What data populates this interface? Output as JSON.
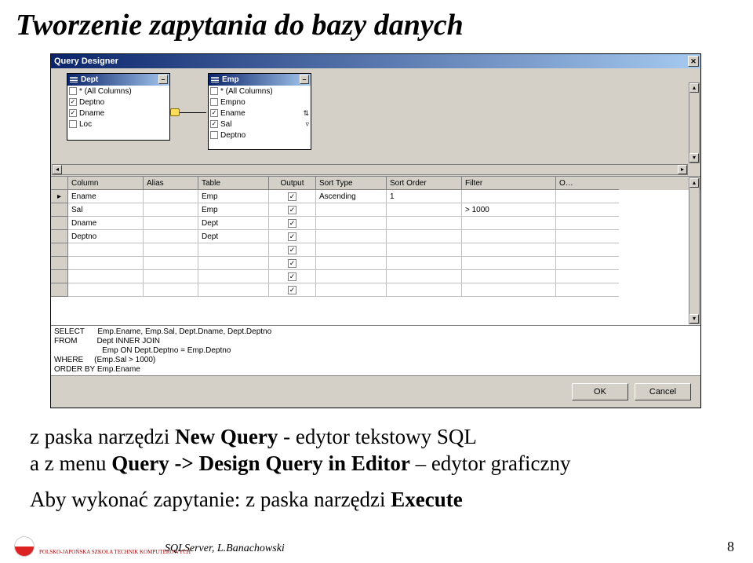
{
  "slide": {
    "title": "Tworzenie zapytania do bazy danych",
    "footer_center": "SQLServer, L.Banachowski",
    "page_num": "8",
    "logo_text": "POLSKO-JAPOŃSKA\nSZKOŁA TECHNIK KOMPUTEROWYCH"
  },
  "qd": {
    "window_title": "Query Designer",
    "tables": [
      {
        "name": "Dept",
        "cols": [
          {
            "label": "* (All Columns)",
            "checked": false
          },
          {
            "label": "Deptno",
            "checked": true
          },
          {
            "label": "Dname",
            "checked": true
          },
          {
            "label": "Loc",
            "checked": false
          }
        ]
      },
      {
        "name": "Emp",
        "cols": [
          {
            "label": "* (All Columns)",
            "checked": false
          },
          {
            "label": "Empno",
            "checked": false
          },
          {
            "label": "Ename",
            "checked": true,
            "sort": "↕"
          },
          {
            "label": "Sal",
            "checked": true,
            "filter": "▾"
          },
          {
            "label": "Deptno",
            "checked": false
          }
        ]
      }
    ],
    "grid_headers": [
      "Column",
      "Alias",
      "Table",
      "Output",
      "Sort Type",
      "Sort Order",
      "Filter",
      "O…"
    ],
    "grid_rows": [
      {
        "column": "Ename",
        "alias": "",
        "table": "Emp",
        "output": true,
        "sort_type": "Ascending",
        "sort_order": "1",
        "filter": ""
      },
      {
        "column": "Sal",
        "alias": "",
        "table": "Emp",
        "output": true,
        "sort_type": "",
        "sort_order": "",
        "filter": "> 1000"
      },
      {
        "column": "Dname",
        "alias": "",
        "table": "Dept",
        "output": true,
        "sort_type": "",
        "sort_order": "",
        "filter": ""
      },
      {
        "column": "Deptno",
        "alias": "",
        "table": "Dept",
        "output": true,
        "sort_type": "",
        "sort_order": "",
        "filter": ""
      },
      {
        "column": "",
        "alias": "",
        "table": "",
        "output": true,
        "sort_type": "",
        "sort_order": "",
        "filter": ""
      },
      {
        "column": "",
        "alias": "",
        "table": "",
        "output": true,
        "sort_type": "",
        "sort_order": "",
        "filter": ""
      },
      {
        "column": "",
        "alias": "",
        "table": "",
        "output": true,
        "sort_type": "",
        "sort_order": "",
        "filter": ""
      },
      {
        "column": "",
        "alias": "",
        "table": "",
        "output": true,
        "sort_type": "",
        "sort_order": "",
        "filter": ""
      }
    ],
    "sql_lines": [
      "SELECT      Emp.Ename, Emp.Sal, Dept.Dname, Dept.Deptno",
      "FROM         Dept INNER JOIN",
      "                      Emp ON Dept.Deptno = Emp.Deptno",
      "WHERE     (Emp.Sal > 1000)",
      "ORDER BY Emp.Ename"
    ],
    "btn_ok": "OK",
    "btn_cancel": "Cancel"
  },
  "bullets": {
    "l1a": "z paska narzędzi ",
    "l1b": "New Query",
    "l1c": "  - edytor tekstowy SQL",
    "l2a": "a z menu ",
    "l2b": "Query -> Design Query in Editor",
    "l2c": " – edytor graficzny",
    "l3a": "Aby wykonać zapytanie: z paska narzędzi ",
    "l3b": "Execute"
  }
}
